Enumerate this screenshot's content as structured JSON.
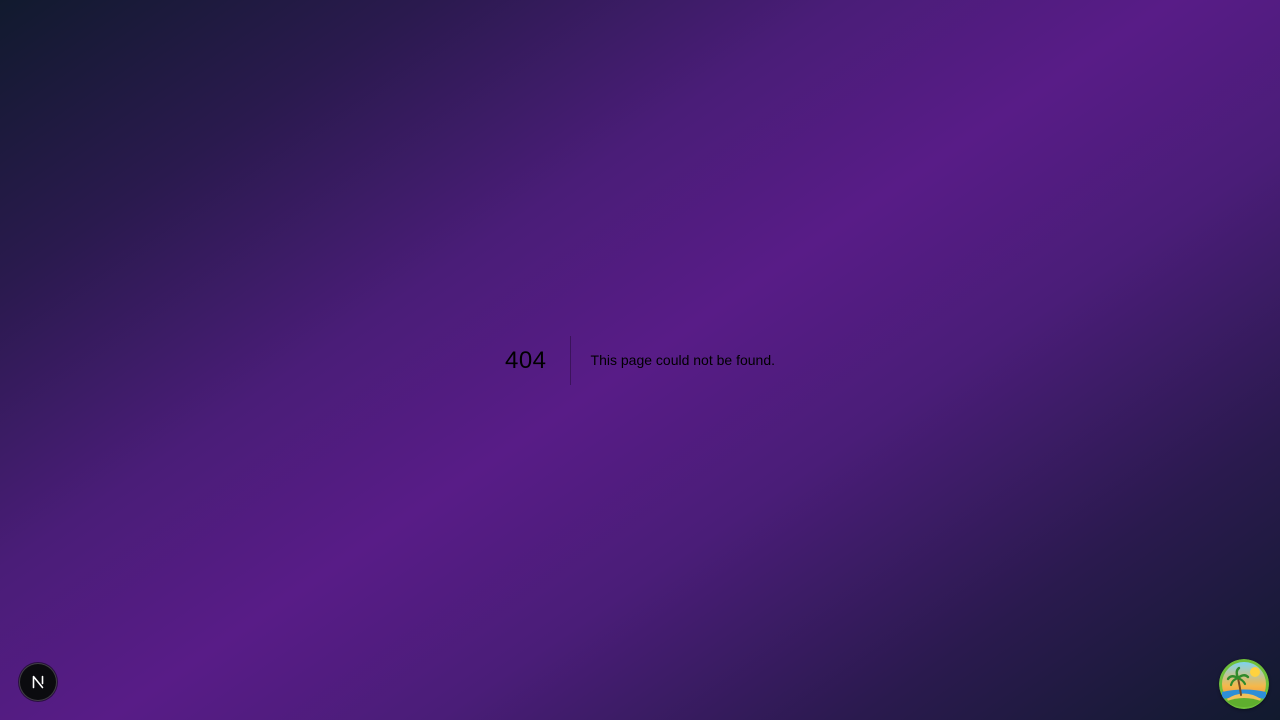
{
  "error": {
    "code": "404",
    "message": "This page could not be found."
  },
  "dev_badge": {
    "icon": "nextjs-logo-icon",
    "letter": "N"
  },
  "avatar": {
    "icon": "tropical-island-avatar-icon"
  },
  "colors": {
    "background_dark": "#111a2e",
    "background_purple": "#581c87",
    "text": "#000000"
  }
}
